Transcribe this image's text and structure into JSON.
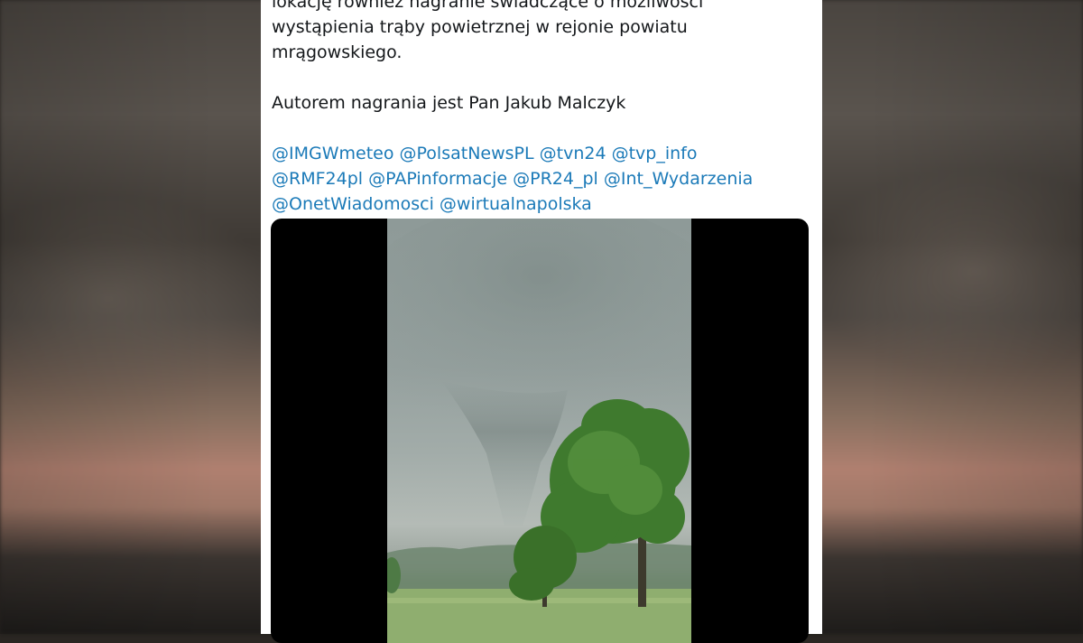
{
  "tweet": {
    "text_lines": [
      "lokację również nagranie świadczące o możliwości",
      "wystąpienia trąby powietrznej w rejonie powiatu",
      "mrągowskiego."
    ],
    "credit": "Autorem nagrania jest Pan Jakub Malczyk",
    "mention_lines": [
      [
        "@IMGWmeteo",
        "@PolsatNewsPL",
        "@tvn24",
        "@tvp_info"
      ],
      [
        "@RMF24pl",
        "@PAPinformacje",
        "@PR24_pl",
        "@Int_Wydarzenia"
      ],
      [
        "@OnetWiadomosci",
        "@wirtualnapolska"
      ]
    ]
  },
  "colors": {
    "mention": "#1b7ab8",
    "text": "#14171a",
    "card_background": "#ffffff",
    "media_background": "#000000"
  },
  "media": {
    "type": "video",
    "content": "funnel cloud over a field with a tree"
  }
}
